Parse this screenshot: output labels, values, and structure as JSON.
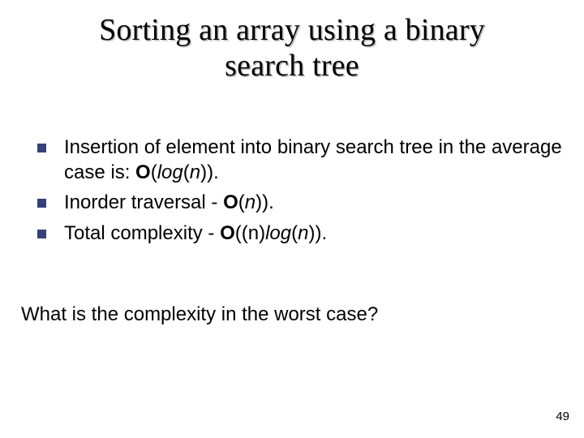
{
  "title": {
    "line1": "Sorting an array using a binary",
    "line2": "search tree"
  },
  "bullets": [
    {
      "pre": "Insertion of element into binary search tree in the average case is: ",
      "bigO": "O",
      "open": "(",
      "fn": "log",
      "mid": "(",
      "var": "n",
      "post": "))."
    },
    {
      "pre": "Inorder traversal - ",
      "bigO": "O",
      "open": "(",
      "var": "n",
      "post": "))."
    },
    {
      "pre": "Total complexity - ",
      "bigO": "O",
      "open": "((n)",
      "fn": "log",
      "mid": "(",
      "var": "n",
      "post": "))."
    }
  ],
  "question": "What is the complexity in the worst case?",
  "page_number": "49"
}
